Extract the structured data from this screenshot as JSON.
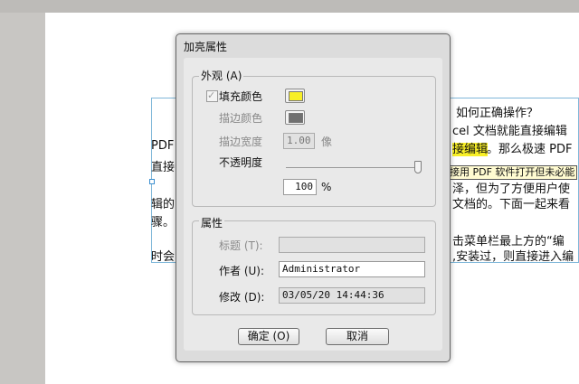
{
  "document": {
    "lines": [
      "如何正确操作？",
      "cel 文档就能直接编辑",
      "PDF",
      "。那么极速 PDF",
      "直接",
      "泽，但为了方便用户使",
      "辑的",
      "文档的。下面一起来看",
      "骤。",
      "击菜单栏最上方的“编",
      "时会",
      ",安装过，则直接进入编"
    ],
    "highlight": "接编辑",
    "tooltip": "接用 PDF 软件打开但未必能"
  },
  "dialog": {
    "title": "加亮属性",
    "appearance": {
      "legend": "外观 (A)",
      "fill_label": "填充颜色",
      "fill_checked": true,
      "fill_color": "#f8ef27",
      "stroke_label": "描边颜色",
      "stroke_color": "#707070",
      "stroke_width_label": "描边宽度",
      "stroke_width_value": "1.00",
      "stroke_width_unit": "像",
      "opacity_label": "不透明度",
      "opacity_value": "100",
      "opacity_unit": "%",
      "opacity_level": 1.0
    },
    "properties": {
      "legend": "属性",
      "title_label": "标题 (T):",
      "title_value": "",
      "author_label": "作者 (U):",
      "author_value": "Administrator",
      "modified_label": "修改 (D):",
      "modified_value": "03/05/20 14:44:36"
    },
    "ok_label": "确定 (O)",
    "cancel_label": "取消"
  }
}
